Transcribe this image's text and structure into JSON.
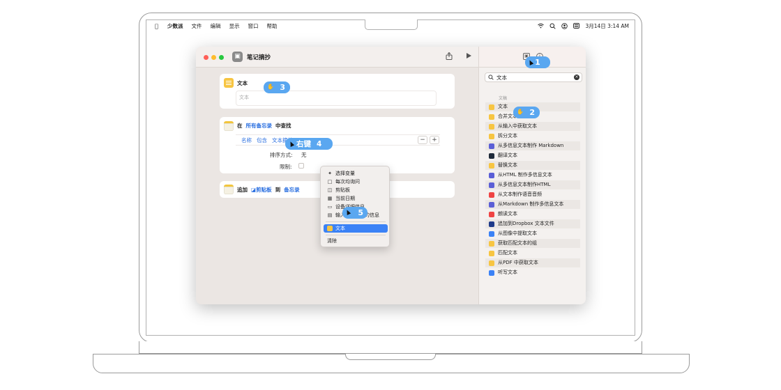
{
  "menubar": {
    "app_name": "少数派",
    "items": [
      "文件",
      "编辑",
      "显示",
      "窗口",
      "帮助"
    ],
    "clock": "3月14日  3:14 AM"
  },
  "window": {
    "title": "笔记摘抄"
  },
  "editor": {
    "text_action": {
      "label": "文本",
      "placeholder": "文本"
    },
    "find_action": {
      "prefix": "在",
      "source": "所有备忘录",
      "suffix": "中查找",
      "filter": {
        "field": "名称",
        "operator": "包含",
        "value": "文本摘抄"
      },
      "sort_label": "排序方式:",
      "sort_value": "无",
      "limit_label": "限制:"
    },
    "append_action": {
      "prefix": "追加",
      "variable": "剪贴板",
      "middle": "到",
      "target": "备忘录"
    }
  },
  "context_menu": {
    "items": [
      {
        "label": "选择变量",
        "icon": "magic-wand-icon"
      },
      {
        "label": "每次均询问",
        "icon": "speech-bubble-icon"
      },
      {
        "label": "剪贴板",
        "icon": "clipboard-icon"
      },
      {
        "label": "当前日期",
        "icon": "calendar-icon"
      },
      {
        "label": "设备详细信息",
        "icon": "monitor-icon"
      },
      {
        "label": "输入快捷指令的信息",
        "icon": "input-icon"
      }
    ],
    "selected": "文本",
    "clear": "清除"
  },
  "sidebar": {
    "search_value": "文本",
    "section": "文稿",
    "items": [
      {
        "label": "文本",
        "color": "#f7c542"
      },
      {
        "label": "合并文本",
        "color": "#f7c542"
      },
      {
        "label": "从输入中获取文本",
        "color": "#f7c542"
      },
      {
        "label": "拆分文本",
        "color": "#f7c542"
      },
      {
        "label": "从多信息文本制作 Markdown",
        "color": "#5b5fd6"
      },
      {
        "label": "翻译文本",
        "color": "#1f2a3a"
      },
      {
        "label": "替换文本",
        "color": "#f7c542"
      },
      {
        "label": "从HTML 制作多信息文本",
        "color": "#5b5fd6"
      },
      {
        "label": "从多信息文本制作HTML",
        "color": "#5b5fd6"
      },
      {
        "label": "从文本制作语音音频",
        "color": "#ef4444"
      },
      {
        "label": "从Markdown 制作多信息文本",
        "color": "#5b5fd6"
      },
      {
        "label": "朗读文本",
        "color": "#ef4444"
      },
      {
        "label": "追加到Dropbox 文本文件",
        "color": "#1e3a8a"
      },
      {
        "label": "从图像中提取文本",
        "color": "#3b82f6"
      },
      {
        "label": "获取匹配文本的组",
        "color": "#f7c542"
      },
      {
        "label": "匹配文本",
        "color": "#f7c542"
      },
      {
        "label": "从PDF 中获取文本",
        "color": "#f7c542"
      },
      {
        "label": "听写文本",
        "color": "#3b82f6"
      }
    ]
  },
  "annotations": {
    "a1": "1",
    "a2": "2",
    "a3": "3",
    "a4_label": "右键",
    "a4": "4",
    "a5": "5"
  }
}
